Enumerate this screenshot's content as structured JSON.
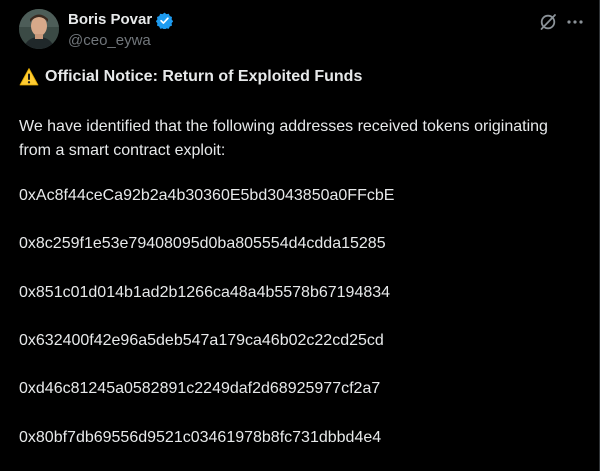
{
  "author": {
    "display_name": "Boris Povar",
    "handle": "@ceo_eywa",
    "verified": true,
    "avatar_icon": "avatar-photo"
  },
  "actions": {
    "grok_icon": "grok-icon",
    "more_icon": "more-icon"
  },
  "post": {
    "title": "Official Notice: Return of Exploited Funds",
    "title_icon": "warning-icon",
    "intro": "We have identified that the following addresses received tokens originating from a smart contract exploit:",
    "addresses": [
      "0xAc8f44ceCa92b2a4b30360E5bd3043850a0FFcbE",
      "0x8c259f1e53e79408095d0ba805554d4cdda15285",
      "0x851c01d014b1ad2b1266ca48a4b5578b67194834",
      "0x632400f42e96a5deb547a179ca46b02c22cd25cd",
      "0xd46c81245a0582891c2249daf2d68925977cf2a7",
      "0x80bf7db69556d9521c03461978b8fc731dbbd4e4"
    ]
  },
  "colors": {
    "background": "#000000",
    "text_primary": "#e7e9ea",
    "text_secondary": "#71767b",
    "verified_blue": "#1d9bf0",
    "warning_yellow": "#ffcc32"
  }
}
